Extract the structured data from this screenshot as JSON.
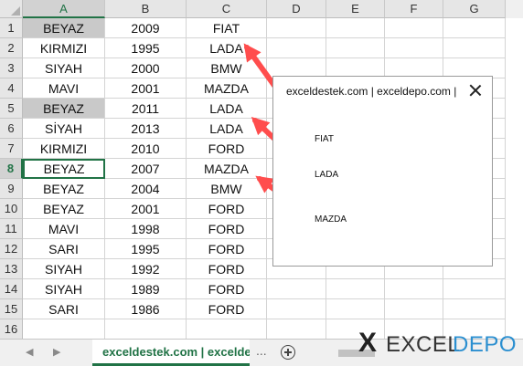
{
  "spreadsheet": {
    "columns": [
      "A",
      "B",
      "C",
      "D",
      "E",
      "F",
      "G"
    ],
    "rows": [
      [
        "BEYAZ",
        "2009",
        "FIAT"
      ],
      [
        "KIRMIZI",
        "1995",
        "LADA"
      ],
      [
        "SIYAH",
        "2000",
        "BMW"
      ],
      [
        "MAVI",
        "2001",
        "MAZDA"
      ],
      [
        "BEYAZ",
        "2011",
        "LADA"
      ],
      [
        "SİYAH",
        "2013",
        "LADA"
      ],
      [
        "KIRMIZI",
        "2010",
        "FORD"
      ],
      [
        "BEYAZ",
        "2007",
        "MAZDA"
      ],
      [
        "BEYAZ",
        "2004",
        "BMW"
      ],
      [
        "BEYAZ",
        "2001",
        "FORD"
      ],
      [
        "MAVI",
        "1998",
        "FORD"
      ],
      [
        "SARI",
        "1995",
        "FORD"
      ],
      [
        "SIYAH",
        "1992",
        "FORD"
      ],
      [
        "SIYAH",
        "1989",
        "FORD"
      ],
      [
        "SARI",
        "1986",
        "FORD"
      ],
      [
        "",
        "",
        ""
      ]
    ],
    "highlighted_rows": [
      1,
      5
    ],
    "active_cell": "A8",
    "colors": {
      "highlight": "#c9c9c9",
      "accent": "#217346",
      "arrow": "#ff4d4d"
    }
  },
  "dialog": {
    "title": "exceldestek.com | exceldepo.com |",
    "close_icon": "close-icon",
    "labels": [
      "FIAT",
      "LADA",
      "MAZDA"
    ]
  },
  "tabbar": {
    "sheet_tab_label": "exceldestek.com | exceldepo.com",
    "more_tabs": "...",
    "prev_icon": "triangle-left-icon",
    "next_icon": "triangle-right-icon",
    "add_icon": "plus-circle-icon",
    "scroll_left": "◀",
    "scroll_right": "▶"
  },
  "logo": {
    "mark": "X",
    "text_left": "EXCEL",
    "text_right": "DEPO"
  }
}
